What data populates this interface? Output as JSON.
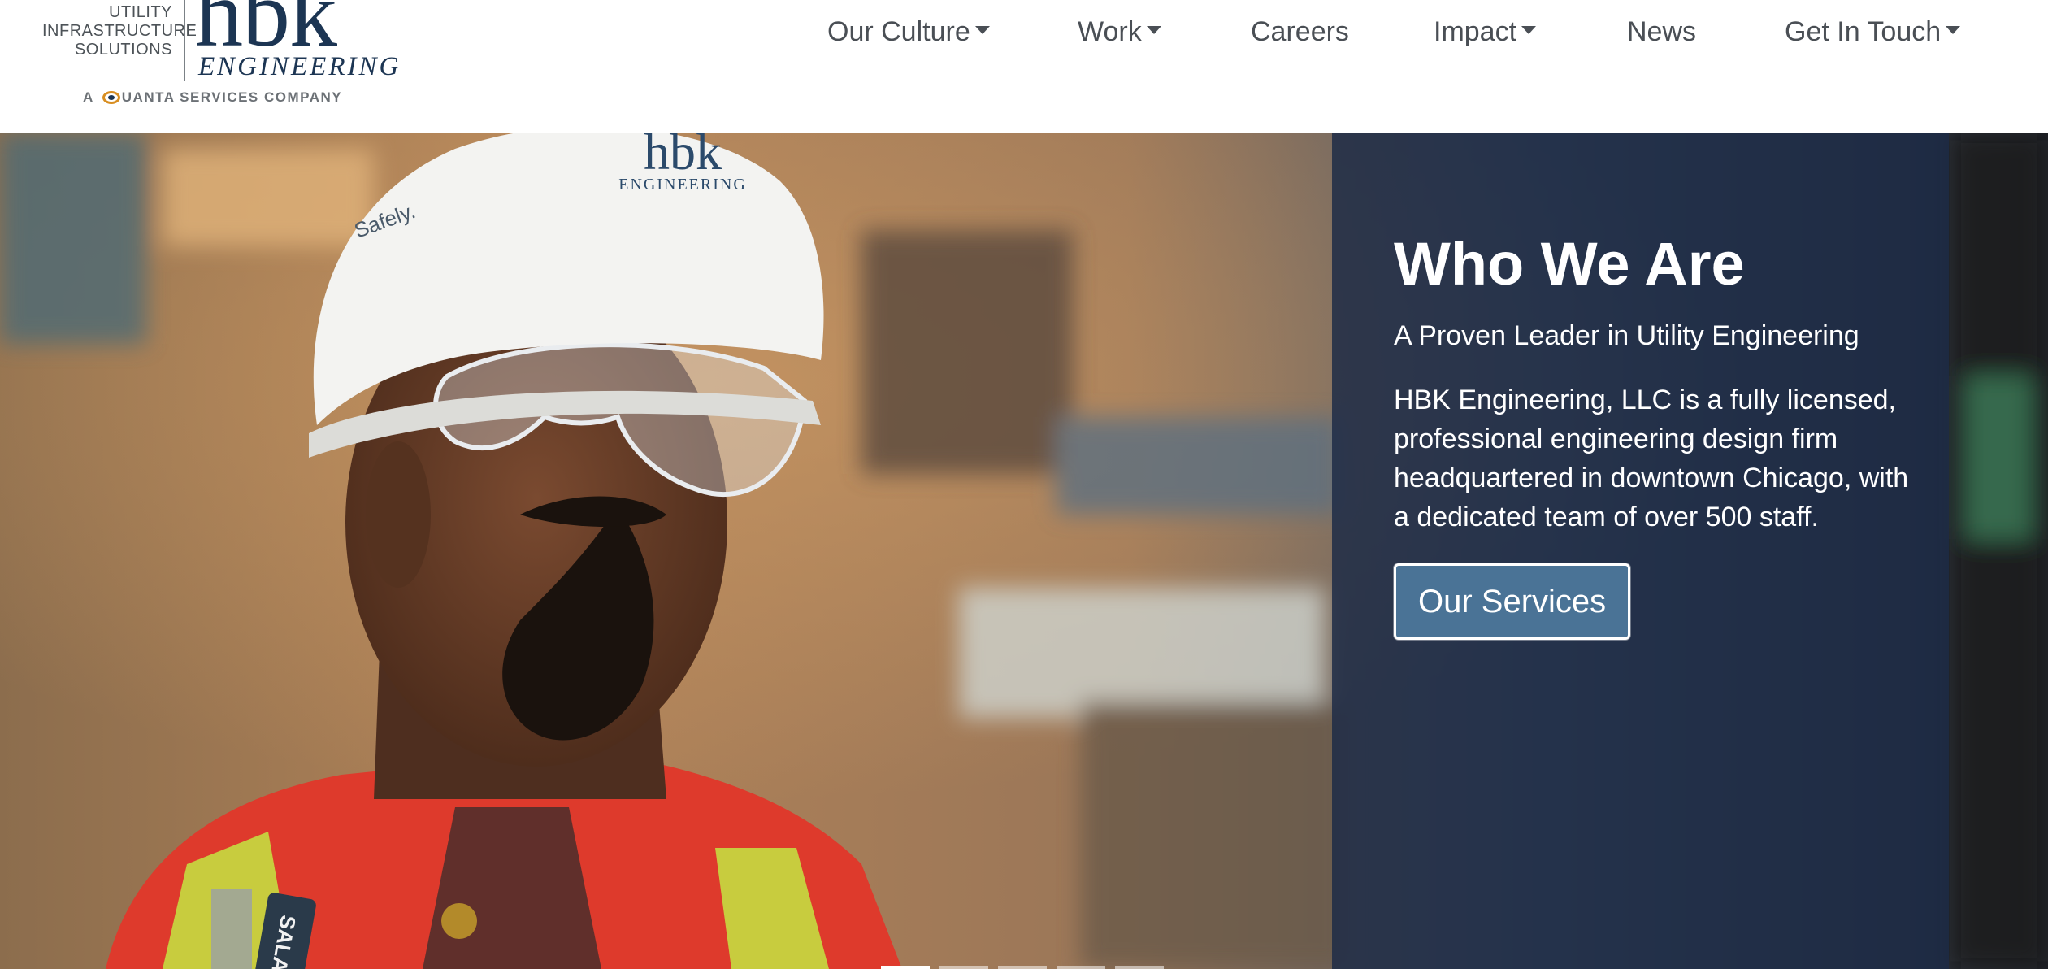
{
  "logo": {
    "descriptor_lines": [
      "UTILITY",
      "INFRASTRUCTURE",
      "SOLUTIONS"
    ],
    "wordmark": "hbk",
    "wordmark_sub": "ENGINEERING",
    "tagline_prefix": "A",
    "tagline_rest": "UANTA SERVICES COMPANY"
  },
  "nav": {
    "items": [
      {
        "label": "Our Culture",
        "dropdown": true
      },
      {
        "label": "Work",
        "dropdown": true
      },
      {
        "label": "Careers",
        "dropdown": false
      },
      {
        "label": "Impact",
        "dropdown": true
      },
      {
        "label": "News",
        "dropdown": false
      },
      {
        "label": "Get In Touch",
        "dropdown": true
      }
    ]
  },
  "hero": {
    "title": "Who We Are",
    "subtitle": "A Proven Leader in Utility Engineering",
    "body": "HBK Engineering, LLC is a fully licensed, professional engineering design firm headquartered in downtown Chicago, with a dedicated team of over 500 staff.",
    "cta_label": "Our Services",
    "slide_count": 5,
    "active_slide": 1
  },
  "colors": {
    "brand_navy": "#1c3553",
    "panel_bg": "#1d2b46",
    "cta_bg": "#4a7396",
    "nav_text": "#4a4f55"
  }
}
